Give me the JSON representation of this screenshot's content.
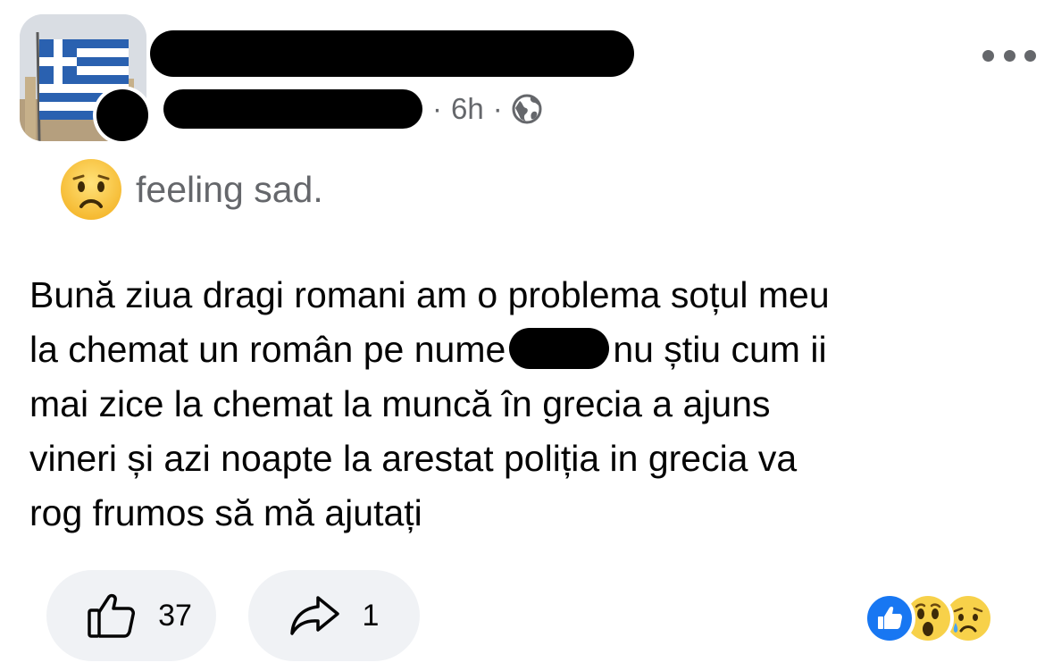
{
  "post": {
    "timestamp": "6h",
    "separator": "·",
    "feeling": "feeling sad.",
    "text": {
      "line1": "Bună ziua dragi romani am o problema soțul meu",
      "line2_before": "la chemat un român pe nume",
      "line2_after": "nu știu cum ii",
      "line3": "mai zice la chemat la muncă în grecia a ajuns",
      "line4": "vineri și azi noapte la arestat poliția in grecia va",
      "line5": "rog frumos să mă ajutați"
    }
  },
  "actions": {
    "like_count": "37",
    "share_count": "1"
  },
  "icons": {
    "privacy": "globe-icon",
    "more": "more-icon",
    "feeling": "sad-face-icon",
    "like": "thumbs-up-icon",
    "share": "share-arrow-icon",
    "reactions": [
      "like-reaction-icon",
      "wow-reaction-icon",
      "sad-reaction-icon"
    ]
  },
  "colors": {
    "secondary_text": "#65676b",
    "pill_background": "#f0f2f5",
    "like_blue": "#1877f2",
    "reaction_yellow": "#f7d14a"
  }
}
